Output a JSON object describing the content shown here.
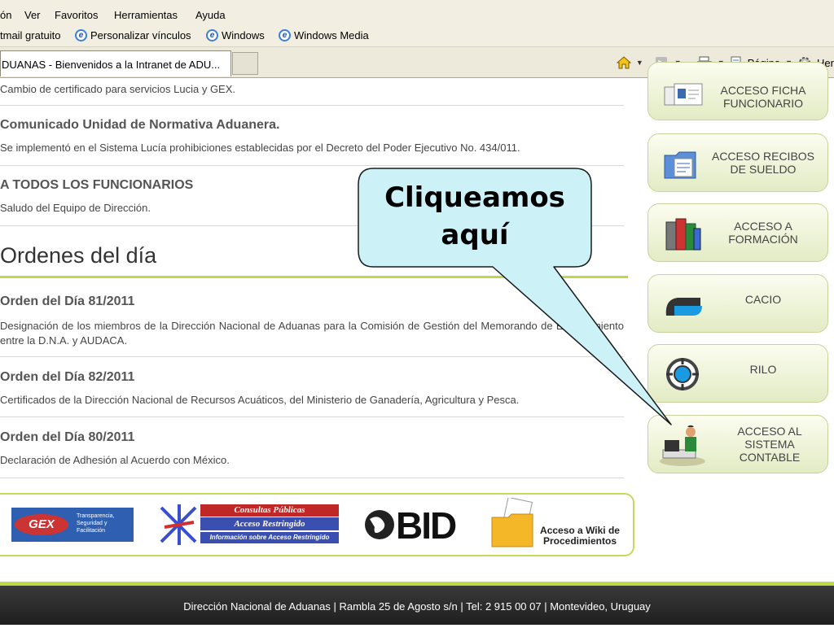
{
  "menu": [
    "ón",
    "Ver",
    "Favoritos",
    "Herramientas",
    "Ayuda"
  ],
  "links": [
    "tmail gratuito",
    "Personalizar vínculos",
    "Windows",
    "Windows Media"
  ],
  "tab": {
    "title": "DUANAS - Bienvenidos a la Intranet de ADU..."
  },
  "command_bar": {
    "page_label": "Página",
    "tools_label": "Her"
  },
  "news": [
    {
      "text": "Cambio de certificado para servicios Lucia y GEX."
    },
    {
      "title": "Comunicado Unidad de Normativa Aduanera.",
      "text": "Se implementó en el Sistema Lucía prohibiciones establecidas por el Decreto del Poder Ejecutivo No. 434/011."
    },
    {
      "title": "A TODOS LOS FUNCIONARIOS",
      "text": "Saludo del Equipo de Dirección."
    }
  ],
  "ordenes": {
    "heading": "Ordenes del día",
    "items": [
      {
        "title": "Orden del Día 81/2011",
        "text": "Designación de los miembros de la Dirección Nacional de Aduanas para la Comisión de Gestión del Memorando de Entendimiento entre la D.N.A. y AUDACA."
      },
      {
        "title": "Orden del Día 82/2011",
        "text": "Certificados de la Dirección Nacional de Recursos Acuáticos, del Ministerio de Ganadería, Agricultura y Pesca."
      },
      {
        "title": "Orden del Día 80/2011",
        "text": "Declaración de Adhesión al Acuerdo con México."
      }
    ]
  },
  "banners": {
    "gex": {
      "logo": "GEX",
      "text": "Transparencia, Seguridad y Facilitación"
    },
    "consultas": {
      "line1": "Consultas Públicas",
      "line2": "Acceso Restringido",
      "line3": "Información sobre Acceso Restringido"
    },
    "bid": {
      "logo": "BID"
    },
    "wiki": {
      "text": "Acceso a Wiki de Procedimientos"
    }
  },
  "side_buttons": [
    {
      "label": "ACCESO FICHA\nFUNCIONARIO",
      "icon": "id-card-icon"
    },
    {
      "label": "ACCESO RECIBOS\nDE SUELDO",
      "icon": "folder-document-icon"
    },
    {
      "label": "ACCESO A\nFORMACIÓN",
      "icon": "books-icon"
    },
    {
      "label": "CACIO",
      "icon": "cacio-logo-icon"
    },
    {
      "label": "RILO",
      "icon": "rilo-logo-icon"
    },
    {
      "label": "ACCESO AL\nSISTEMA\nCONTABLE",
      "icon": "accountant-icon"
    }
  ],
  "footer": {
    "text": "Dirección Nacional de Aduanas | Rambla 25 de Agosto s/n | Tel: 2 915 00 07 | Montevideo, Uruguay"
  },
  "callout": {
    "text": "Cliqueamos aquí",
    "fill": "#ccf2f8",
    "stroke": "#1a1a1a"
  },
  "colors": {
    "accent_green": "#bcd94a",
    "footer_bg": "#2a2a2a",
    "chrome_bg": "#f2efe2"
  }
}
